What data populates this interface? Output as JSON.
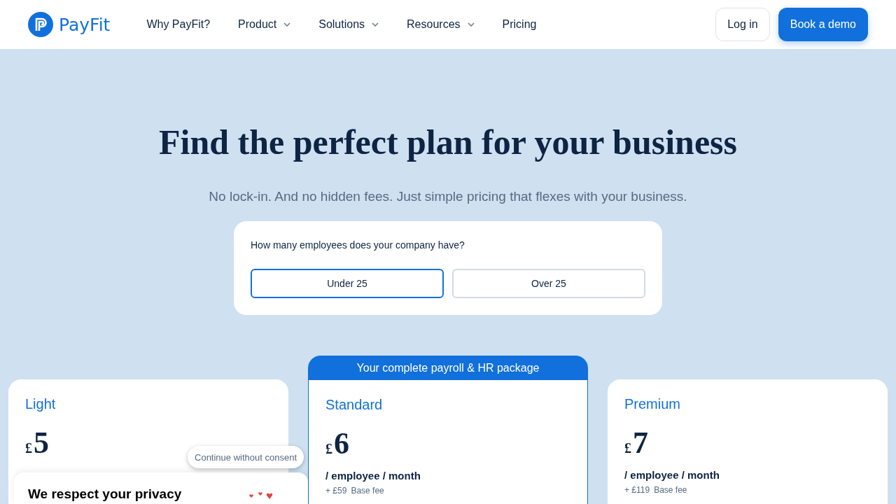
{
  "header": {
    "brand": "PayFit",
    "nav": [
      {
        "label": "Why PayFit?",
        "dropdown": false
      },
      {
        "label": "Product",
        "dropdown": true
      },
      {
        "label": "Solutions",
        "dropdown": true
      },
      {
        "label": "Resources",
        "dropdown": true
      },
      {
        "label": "Pricing",
        "dropdown": false
      }
    ],
    "login": "Log in",
    "cta": "Book a demo"
  },
  "hero": {
    "title": "Find the perfect plan for your business",
    "subtitle": "No lock-in. And no hidden fees. Just simple pricing that flexes with your business."
  },
  "employees": {
    "question": "How many employees does your company have?",
    "options": [
      {
        "label": "Under 25",
        "selected": true
      },
      {
        "label": "Over 25",
        "selected": false
      }
    ]
  },
  "plans": [
    {
      "name": "Light",
      "currency": "£",
      "price": "5",
      "featured": false
    },
    {
      "name": "Standard",
      "currency": "£",
      "price": "6",
      "unit": "/ employee / month",
      "base_amount": "+ £59",
      "base_label": "Base fee",
      "featured": true,
      "banner": "Your complete payroll & HR package"
    },
    {
      "name": "Premium",
      "currency": "£",
      "price": "7",
      "unit": "/ employee / month",
      "base_amount": "+ £119",
      "base_label": "Base fee",
      "featured": false
    }
  ],
  "cookie": {
    "skip": "Continue without consent",
    "title": "We respect your privacy"
  }
}
